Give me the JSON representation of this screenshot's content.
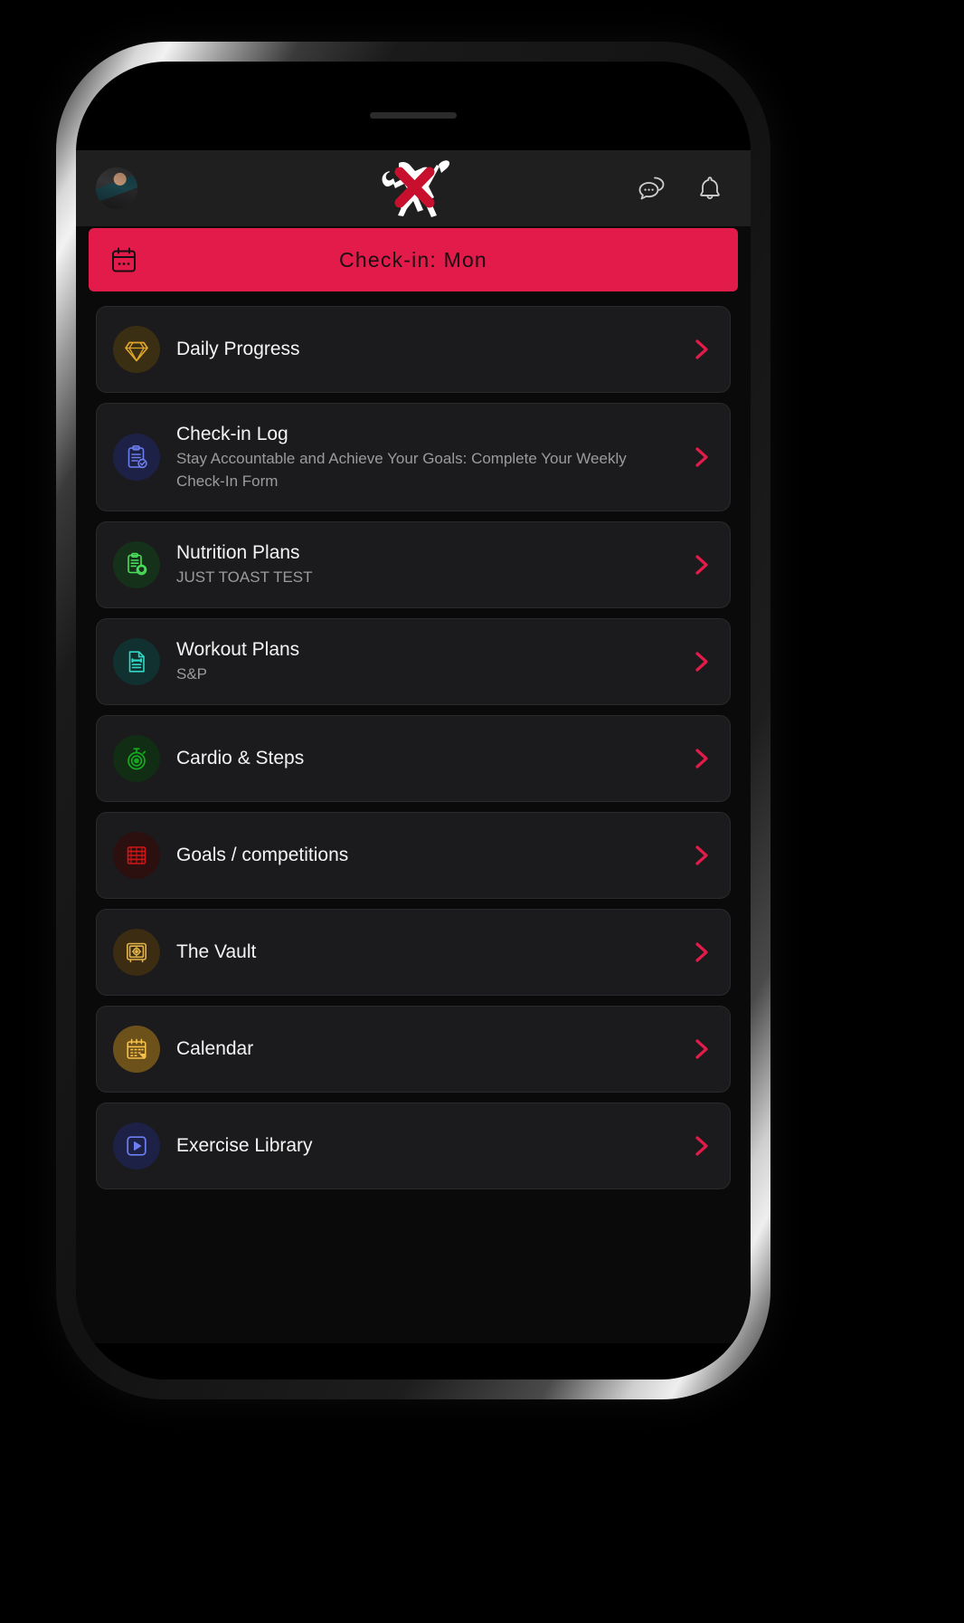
{
  "header": {
    "avatar_name": "user-avatar",
    "logo_name": "bull-x-logo",
    "messages_label": "Messages",
    "notifications_label": "Notifications"
  },
  "checkin": {
    "label": "Check-in: Mon",
    "icon": "calendar-icon",
    "accent": "#e31b4b"
  },
  "cards": [
    {
      "title": "Daily Progress",
      "subtitle": "",
      "icon": "diamond-icon",
      "icon_color": "#e0a52a",
      "icon_bg": "#3a2f12"
    },
    {
      "title": "Check-in Log",
      "subtitle": "Stay Accountable and Achieve Your Goals: Complete Your Weekly Check-In Form",
      "icon": "clipboard-check-icon",
      "icon_color": "#6d7ff0",
      "icon_bg": "#1d2146"
    },
    {
      "title": "Nutrition Plans",
      "subtitle": "JUST TOAST TEST",
      "icon": "nutrition-clipboard-icon",
      "icon_color": "#4ade5a",
      "icon_bg": "#15311a"
    },
    {
      "title": "Workout Plans",
      "subtitle": "S&P",
      "icon": "workout-document-icon",
      "icon_color": "#2fd9c5",
      "icon_bg": "#10312f"
    },
    {
      "title": "Cardio & Steps",
      "subtitle": "",
      "icon": "stopwatch-icon",
      "icon_color": "#16a81f",
      "icon_bg": "#112d14"
    },
    {
      "title": "Goals / competitions",
      "subtitle": "",
      "icon": "abacus-icon",
      "icon_color": "#d01616",
      "icon_bg": "#2c0f0f"
    },
    {
      "title": "The Vault",
      "subtitle": "",
      "icon": "safe-vault-icon",
      "icon_color": "#e3b24a",
      "icon_bg": "#3b2c12"
    },
    {
      "title": "Calendar",
      "subtitle": "",
      "icon": "calendar-days-icon",
      "icon_color": "#f7c04a",
      "icon_bg": "#6d511a"
    },
    {
      "title": "Exercise Library",
      "subtitle": "",
      "icon": "video-play-icon",
      "icon_color": "#6d7ff0",
      "icon_bg": "#1d2146"
    }
  ],
  "chevron_color": "#e31b4b"
}
